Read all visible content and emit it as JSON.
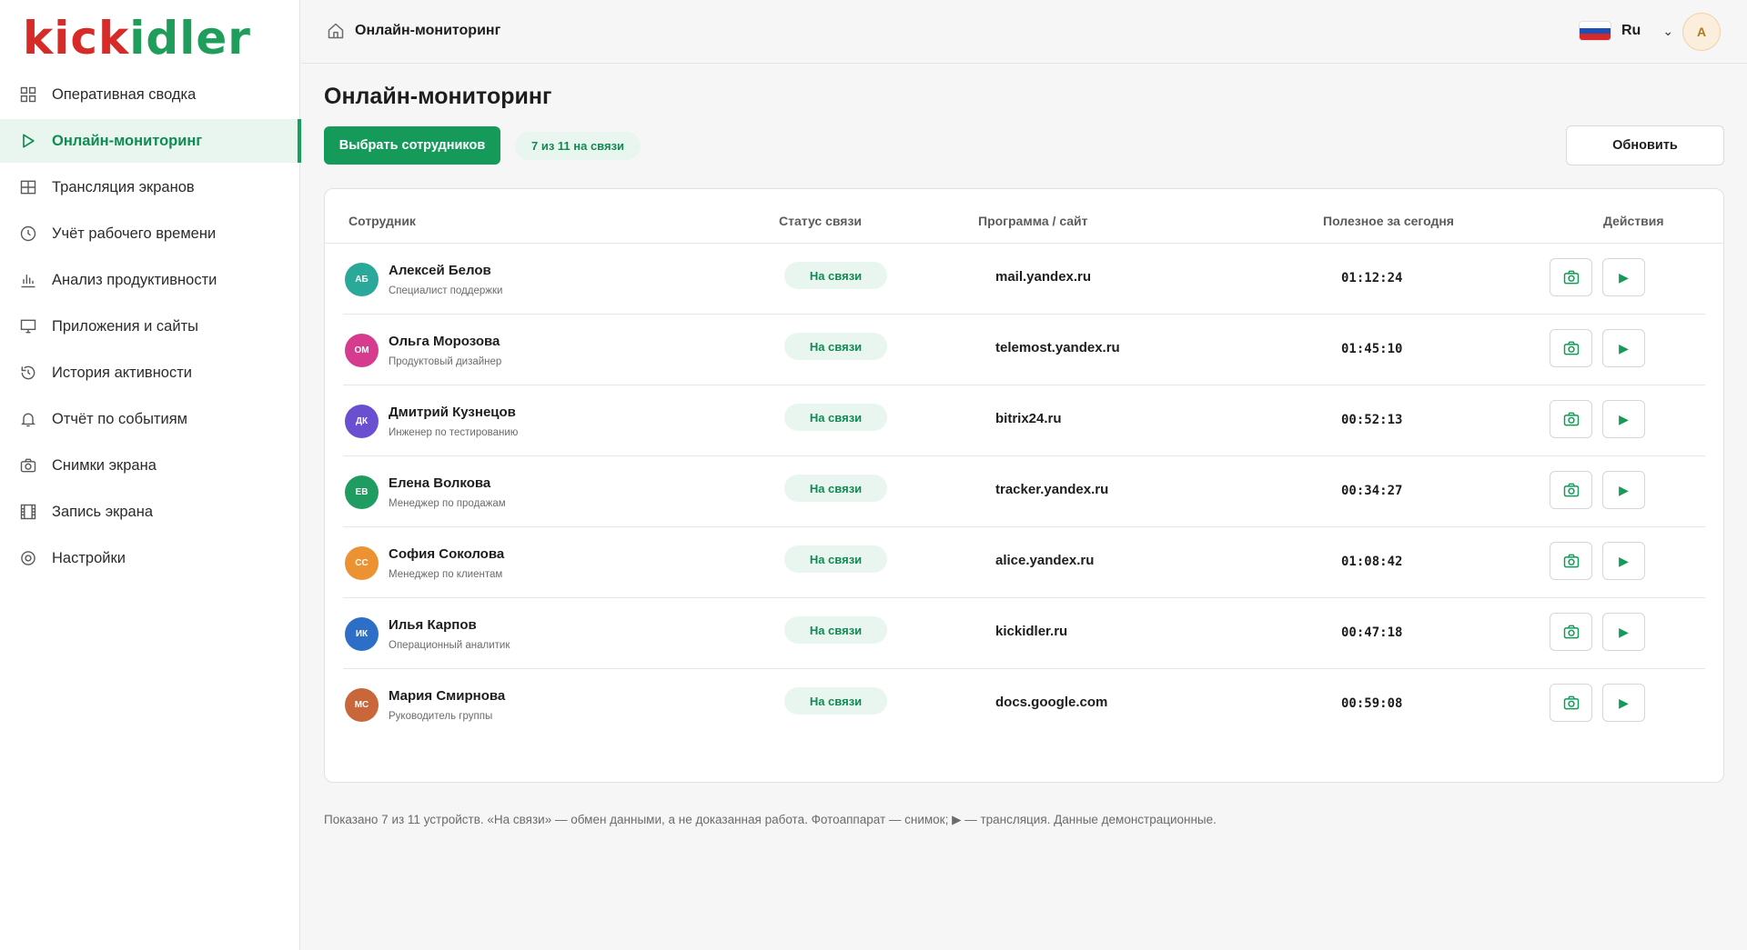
{
  "brand": {
    "logo_part1": "kick",
    "logo_part2": "idler"
  },
  "sidebar": {
    "items": [
      {
        "label": "Оперативная сводка",
        "icon": "grid-icon"
      },
      {
        "label": "Онлайн-мониторинг",
        "icon": "play-outline-icon",
        "active": true
      },
      {
        "label": "Трансляция экранов",
        "icon": "table-icon"
      },
      {
        "label": "Учёт рабочего времени",
        "icon": "clock-icon"
      },
      {
        "label": "Анализ продуктивности",
        "icon": "bar-chart-icon"
      },
      {
        "label": "Приложения и сайты",
        "icon": "monitor-icon"
      },
      {
        "label": "История активности",
        "icon": "history-icon"
      },
      {
        "label": "Отчёт по событиям",
        "icon": "bell-icon"
      },
      {
        "label": "Снимки экрана",
        "icon": "camera-icon"
      },
      {
        "label": "Запись экрана",
        "icon": "film-icon"
      },
      {
        "label": "Настройки",
        "icon": "settings-icon"
      }
    ]
  },
  "header": {
    "breadcrumb": "Онлайн-мониторинг",
    "language": "Ru",
    "avatar_initial": "A"
  },
  "main": {
    "title": "Онлайн-мониторинг",
    "select_button": "Выбрать сотрудников",
    "online_count": "7 из 11 на связи",
    "refresh_button": "Обновить",
    "table": {
      "headers": {
        "employee": "Сотрудник",
        "status": "Статус связи",
        "app": "Программа / сайт",
        "useful": "Полезное за сегодня",
        "actions": "Действия"
      },
      "rows": [
        {
          "initials": "АБ",
          "avatar_color": "#2aa89a",
          "name": "Алексей Белов",
          "role": "Специалист поддержки",
          "status": "На связи",
          "app": "mail.yandex.ru",
          "time": "01:12:24"
        },
        {
          "initials": "ОМ",
          "avatar_color": "#d63b8e",
          "name": "Ольга Морозова",
          "role": "Продуктовый дизайнер",
          "status": "На связи",
          "app": "telemost.yandex.ru",
          "time": "01:45:10"
        },
        {
          "initials": "ДК",
          "avatar_color": "#6b4fd1",
          "name": "Дмитрий Кузнецов",
          "role": "Инженер по тестированию",
          "status": "На связи",
          "app": "bitrix24.ru",
          "time": "00:52:13"
        },
        {
          "initials": "ЕВ",
          "avatar_color": "#1e9c62",
          "name": "Елена Волкова",
          "role": "Менеджер по продажам",
          "status": "На связи",
          "app": "tracker.yandex.ru",
          "time": "00:34:27"
        },
        {
          "initials": "СС",
          "avatar_color": "#ec9232",
          "name": "София Соколова",
          "role": "Менеджер по клиентам",
          "status": "На связи",
          "app": "alice.yandex.ru",
          "time": "01:08:42"
        },
        {
          "initials": "ИК",
          "avatar_color": "#2d6fc7",
          "name": "Илья Карпов",
          "role": "Операционный аналитик",
          "status": "На связи",
          "app": "kickidler.ru",
          "time": "00:47:18"
        },
        {
          "initials": "МС",
          "avatar_color": "#c9663a",
          "name": "Мария Смирнова",
          "role": "Руководитель группы",
          "status": "На связи",
          "app": "docs.google.com",
          "time": "00:59:08"
        }
      ]
    },
    "footnote": "Показано 7 из 11 устройств. «На связи» — обмен данными, а не доказанная работа. Фотоаппарат — снимок; ▶ — трансляция. Данные демонстрационные."
  },
  "colors": {
    "accent": "#159a5a",
    "logo_red": "#d72b28",
    "logo_green": "#1e9e5a"
  }
}
